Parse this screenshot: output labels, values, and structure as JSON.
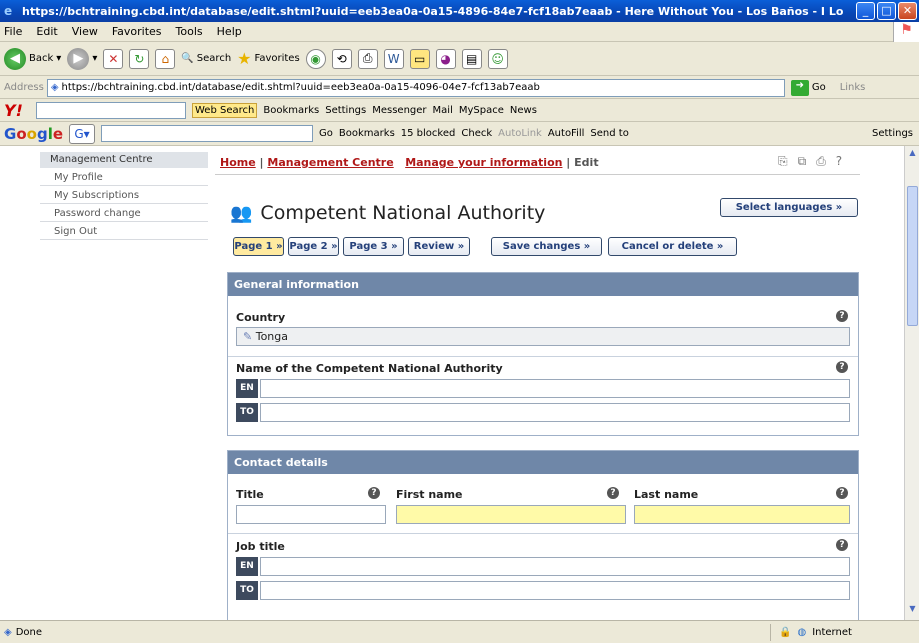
{
  "window": {
    "title": "https://bchtraining.cbd.int/database/edit.shtml?uuid=eeb3ea0a-0a15-4896-84e7-fcf18ab7eaab - Here Without You - Los Baños - I Lo"
  },
  "menubar": {
    "items": [
      "File",
      "Edit",
      "View",
      "Favorites",
      "Tools",
      "Help"
    ]
  },
  "toolbar": {
    "back": "Back",
    "search": "Search",
    "favorites": "Favorites"
  },
  "address": {
    "label": "Address",
    "url": "https://bchtraining.cbd.int/database/edit.shtml?uuid=eeb3ea0a-0a15-4096-04e7-fcf13ab7eaab",
    "go": "Go",
    "links": "Links"
  },
  "yahoo": {
    "web_search": "Web Search",
    "bookmarks": "Bookmarks",
    "settings": "Settings",
    "messenger": "Messenger",
    "mail": "Mail",
    "myspace": "MySpace",
    "news": "News"
  },
  "google": {
    "go": "Go",
    "bookmarks": "Bookmarks",
    "blocked": "15 blocked",
    "check": "Check",
    "autolink": "AutoLink",
    "autofill": "AutoFill",
    "sendto": "Send to",
    "settings": "Settings"
  },
  "sidebar": {
    "header": "Management Centre",
    "items": [
      {
        "label": "My Profile"
      },
      {
        "label": "My Subscriptions"
      },
      {
        "label": "Password change"
      },
      {
        "label": "Sign Out"
      }
    ]
  },
  "breadcrumb": {
    "home": "Home",
    "mgmt": "Management Centre",
    "manage": "Manage your information",
    "edit": "Edit"
  },
  "page": {
    "title": "Competent National Authority",
    "select_language": "Select languages »"
  },
  "buttons": {
    "page1": "Page 1 »",
    "page2": "Page 2 »",
    "page3": "Page 3 »",
    "review": "Review »",
    "save": "Save changes »",
    "cancel": "Cancel or delete »"
  },
  "general": {
    "header": "General information",
    "country_label": "Country",
    "country_value": "Tonga",
    "cna_name_label": "Name of the Competent National Authority",
    "lang_en": "EN",
    "lang_to": "TO"
  },
  "contact": {
    "header": "Contact details",
    "title_label": "Title",
    "first_label": "First name",
    "last_label": "Last name",
    "job_label": "Job title",
    "lang_en": "EN",
    "lang_to": "TO"
  },
  "status": {
    "left": "Done",
    "zone": "Internet"
  }
}
